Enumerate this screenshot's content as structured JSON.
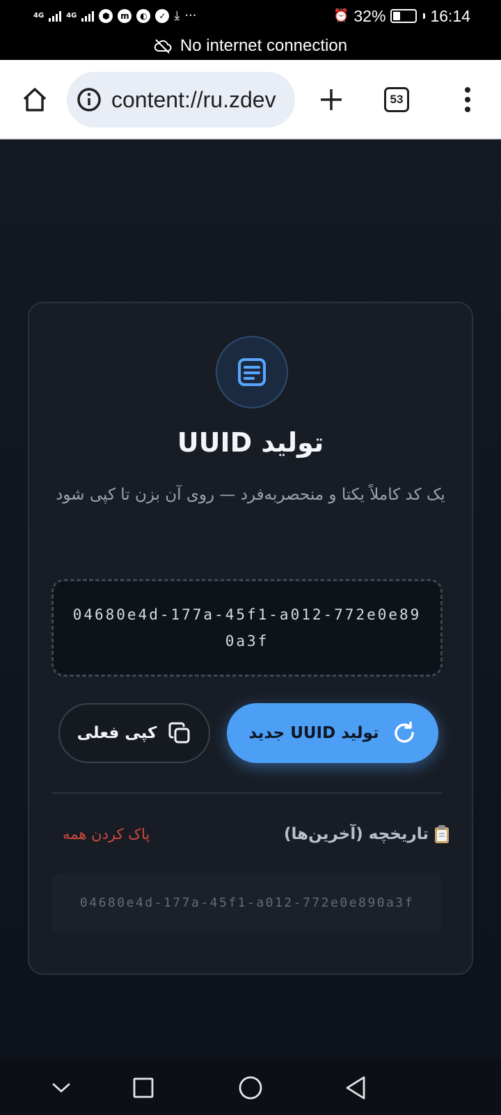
{
  "status_bar": {
    "network_1": "4G",
    "network_2": "4G",
    "battery": "32%",
    "time": "16:14"
  },
  "offline_banner": {
    "text": "No internet connection"
  },
  "browser": {
    "url": "content://ru.zdev",
    "tab_count": "53"
  },
  "app": {
    "title": "تولید UUID",
    "subtitle": "یک کد کاملاً یکتا و منحصربه‌فرد — روی آن بزن تا کپی شود",
    "current_uuid": "04680e4d-177a-45f1-a012-772e0e890a3f",
    "generate_button": "تولید UUID جدید",
    "copy_button": "کپی فعلی",
    "history_title": "تاریخچه (آخرین‌ها)",
    "clear_all": "پاک کردن همه",
    "history": [
      "04680e4d-177a-45f1-a012-772e0e890a3f"
    ]
  },
  "colors": {
    "accent": "#4d9ef5",
    "danger": "#d0493f",
    "background": "#0f131a",
    "card": "#181d25"
  }
}
